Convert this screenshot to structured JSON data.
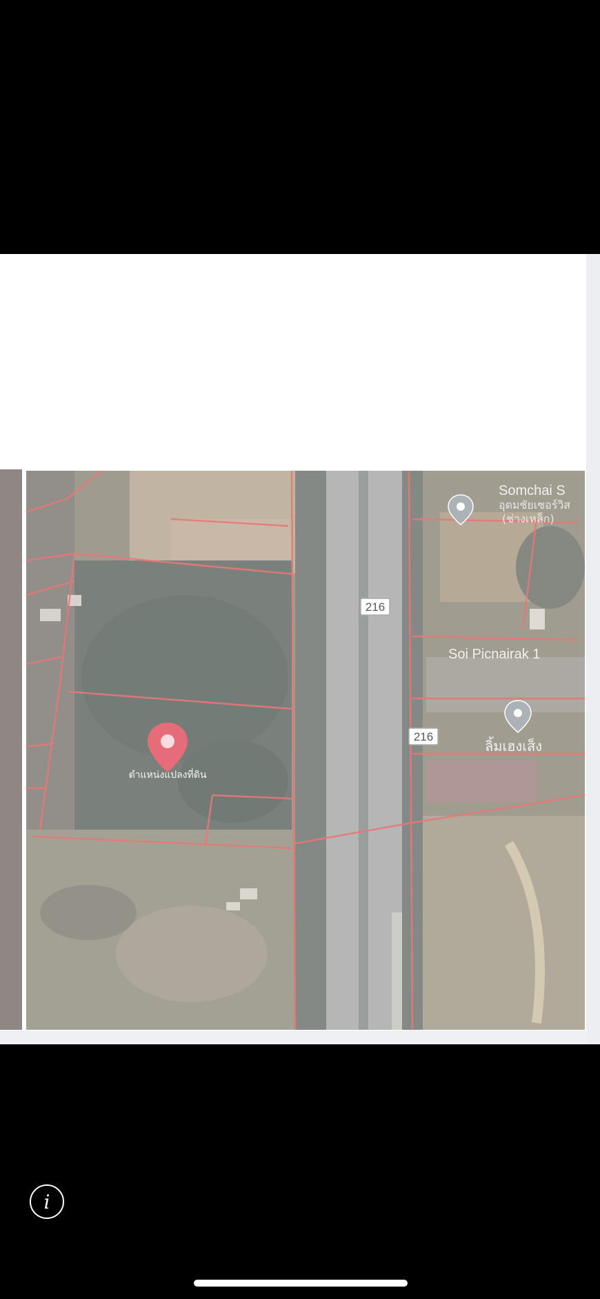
{
  "map": {
    "road_shield_1": "216",
    "road_shield_2": "216",
    "street_label": "Soi Picnairak 1",
    "place_label_1": "Somchai S",
    "place_label_1_sub": "อุดมชัยเซอร์วิส",
    "place_label_1_sub2": "(ช่างเหล็ก)",
    "place_label_2": "ลิ้มเฮงเส็ง",
    "pin_label": "ตำแหน่งแปลงที่ดิน"
  },
  "icons": {
    "info": "info-icon",
    "location_pin": "location-pin-icon",
    "poi_pin": "poi-pin-icon"
  },
  "colors": {
    "parcel_line": "#e35a5a",
    "pin_red": "#e24c5c",
    "poi_gray": "#9aa3a9"
  },
  "info_glyph": "i"
}
